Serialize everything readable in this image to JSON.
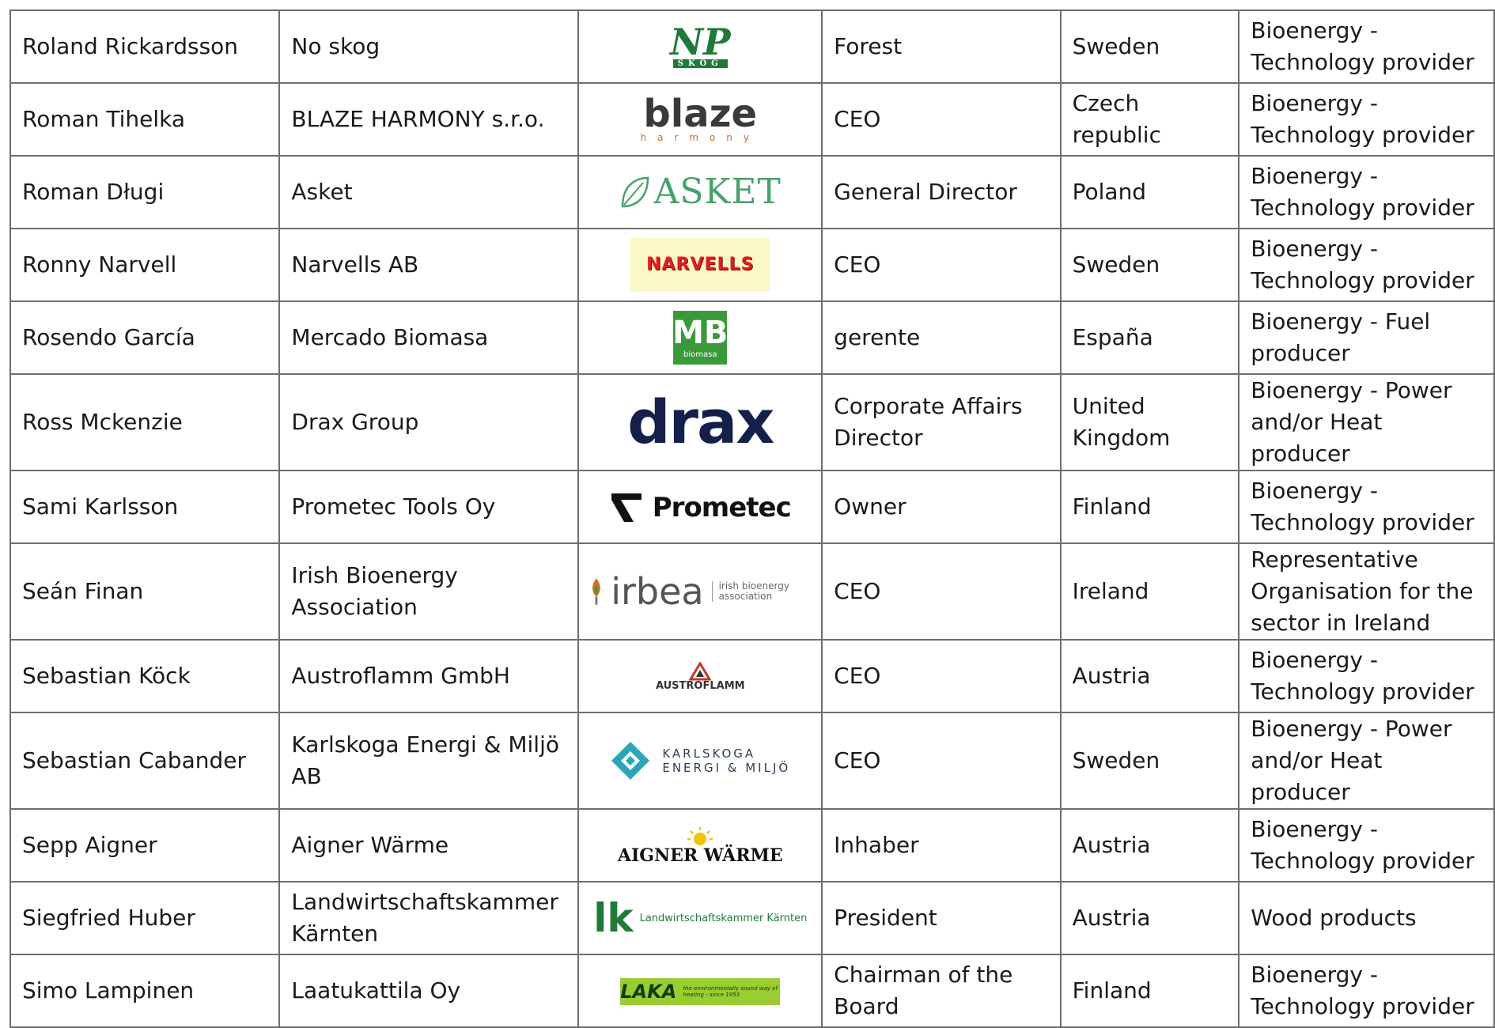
{
  "rows": [
    {
      "name": "Roland Rickardsson",
      "organisation": "No skog",
      "logo_icon": "np-skog-logo",
      "logo_text": "NP",
      "logo_sub": "SKOG",
      "position": "Forest",
      "country": "Sweden",
      "sector": "Bioenergy - Technology provider"
    },
    {
      "name": "Roman Tihelka",
      "organisation": "BLAZE HARMONY s.r.o.",
      "logo_icon": "blaze-harmony-logo",
      "logo_text": "blaze",
      "logo_sub": "harmony",
      "position": "CEO",
      "country": "Czech republic",
      "sector": "Bioenergy - Technology provider"
    },
    {
      "name": "Roman Długi",
      "organisation": "Asket",
      "logo_icon": "asket-logo",
      "logo_text": "ASKET",
      "position": "General Director",
      "country": "Poland",
      "sector": "Bioenergy - Technology provider"
    },
    {
      "name": "Ronny Narvell",
      "organisation": "Narvells AB",
      "logo_icon": "narvells-logo",
      "logo_text": "NARVELLS",
      "position": "CEO",
      "country": "Sweden",
      "sector": "Bioenergy - Technology provider"
    },
    {
      "name": "Rosendo García",
      "organisation": "Mercado Biomasa",
      "logo_icon": "mercado-biomasa-logo",
      "logo_text": "MB",
      "logo_sub": "biomasa",
      "position": "gerente",
      "country": "España",
      "sector": "Bioenergy - Fuel producer"
    },
    {
      "name": "Ross Mckenzie",
      "organisation": "Drax Group",
      "logo_icon": "drax-logo",
      "logo_text": "drax",
      "position": "Corporate Affairs Director",
      "country": "United Kingdom",
      "sector": "Bioenergy - Power and/or Heat producer"
    },
    {
      "name": "Sami Karlsson",
      "organisation": "Prometec Tools Oy",
      "logo_icon": "prometec-logo",
      "logo_text": "Prometec",
      "position": "Owner",
      "country": "Finland",
      "sector": "Bioenergy - Technology provider"
    },
    {
      "name": "Seán Finan",
      "organisation": "Irish Bioenergy Association",
      "logo_icon": "irbea-logo",
      "logo_text": "irbea",
      "logo_sub": "irish bioenergy association",
      "position": "CEO",
      "country": "Ireland",
      "sector": "Representative Organisation for the sector in Ireland"
    },
    {
      "name": "Sebastian Köck",
      "organisation": "Austroflamm GmbH",
      "logo_icon": "austroflamm-logo",
      "logo_text": "AUSTROFLAMM",
      "position": "CEO",
      "country": "Austria",
      "sector": "Bioenergy - Technology provider"
    },
    {
      "name": "Sebastian Cabander",
      "organisation": "Karlskoga Energi & Miljö AB",
      "logo_icon": "karlskoga-logo",
      "logo_text": "KARLSKOGA",
      "logo_sub": "ENERGI & MILJÖ",
      "position": "CEO",
      "country": "Sweden",
      "sector": "Bioenergy - Power and/or Heat producer"
    },
    {
      "name": "Sepp Aigner",
      "organisation": "Aigner Wärme",
      "logo_icon": "aigner-waerme-logo",
      "logo_text": "AIGNER WÄRME",
      "position": "Inhaber",
      "country": "Austria",
      "sector": "Bioenergy - Technology provider"
    },
    {
      "name": "Siegfried Huber",
      "organisation": "Landwirtschaftskammer Kärnten",
      "logo_icon": "landwirtschaftskammer-logo",
      "logo_text": "lk",
      "logo_sub": "Landwirtschaftskammer Kärnten",
      "position": "President",
      "country": "Austria",
      "sector": "Wood products"
    },
    {
      "name": "Simo Lampinen",
      "organisation": "Laatukattila Oy",
      "logo_icon": "laka-logo",
      "logo_text": "LAKA",
      "logo_sub": "the environmentally sound way of heating - since 1953",
      "position": "Chairman of the Board",
      "country": "Finland",
      "sector": "Bioenergy - Technology provider"
    }
  ]
}
